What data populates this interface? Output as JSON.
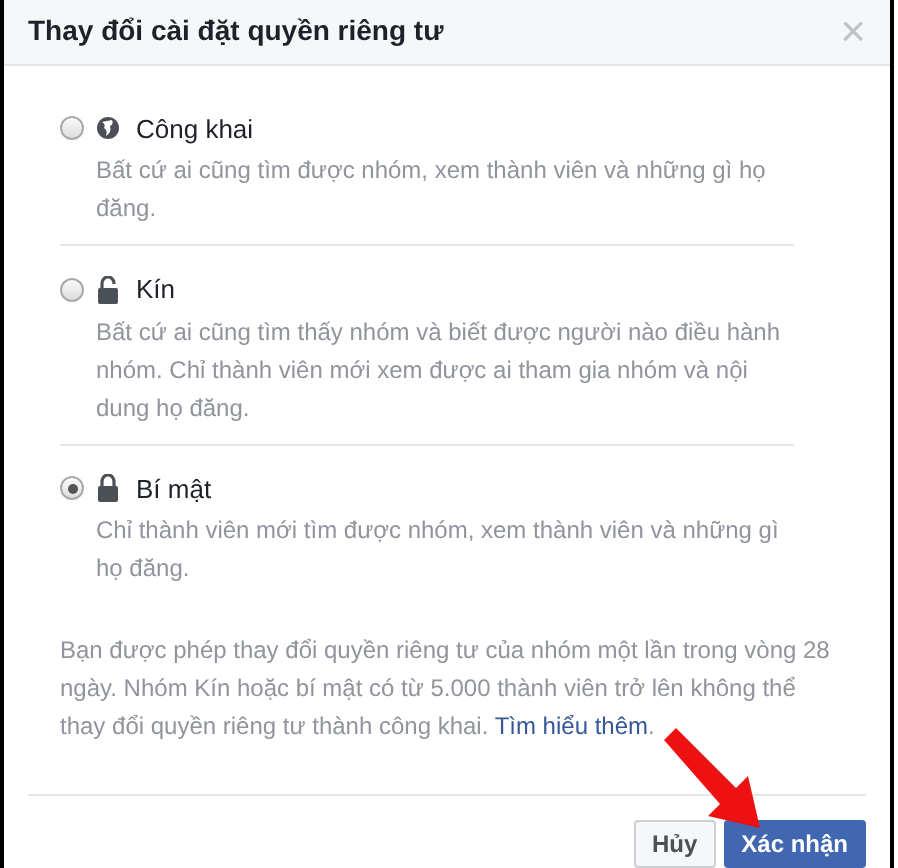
{
  "dialog": {
    "title": "Thay đổi cài đặt quyền riêng tư",
    "close": "×"
  },
  "options": [
    {
      "kind": "public",
      "label": "Công khai",
      "description": "Bất cứ ai cũng tìm được nhóm, xem thành viên và những gì họ đăng.",
      "selected": false
    },
    {
      "kind": "closed",
      "label": "Kín",
      "description": "Bất cứ ai cũng tìm thấy nhóm và biết được người nào điều hành nhóm. Chỉ thành viên mới xem được ai tham gia nhóm và nội dung họ đăng.",
      "selected": false
    },
    {
      "kind": "secret",
      "label": "Bí mật",
      "description": "Chỉ thành viên mới tìm được nhóm, xem thành viên và những gì họ đăng.",
      "selected": true
    }
  ],
  "notice": {
    "text": "Bạn được phép thay đổi quyền riêng tư của nhóm một lần trong vòng 28 ngày. Nhóm Kín hoặc bí mật có từ 5.000 thành viên trở lên không thể thay đổi quyền riêng tư thành công khai.",
    "link": "Tìm hiểu thêm",
    "end": "."
  },
  "buttons": [
    {
      "kind": "cancel",
      "label": "Hủy"
    },
    {
      "kind": "confirm",
      "label": "Xác nhận"
    }
  ]
}
